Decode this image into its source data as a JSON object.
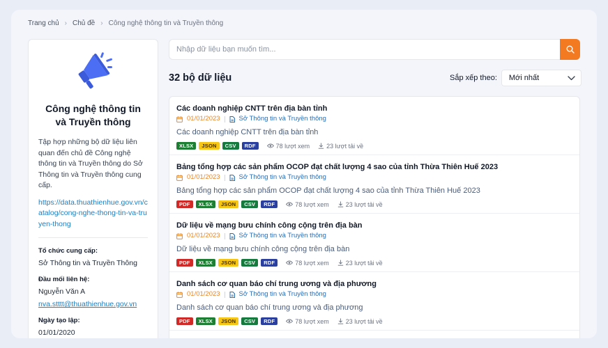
{
  "breadcrumb": {
    "home": "Trang chủ",
    "topics": "Chủ đề",
    "current": "Công nghệ thông tin và Truyền thông"
  },
  "sidebar": {
    "icon": "megaphone-icon",
    "title": "Công nghệ thông tin và Truyền thông",
    "description": "Tập hợp những bộ dữ liệu liên quan đến chủ đề Công nghệ thông tin và Truyền thông do Sở Thông tin và Truyền thông cung cấp.",
    "link": "https://data.thuathienhue.gov.vn/catalog/cong-nghe-thong-tin-va-truyen-thong",
    "provider_label": "Tổ chức cung cấp:",
    "provider_value": "Sở Thông tin và Truyền Thông",
    "contact_label": "Đầu mối liên hệ:",
    "contact_name": "Nguyễn Văn A",
    "contact_email": "nva.stttt@thuathienhue.gov.vn",
    "created_label": "Ngày tạo lập:",
    "created_value": "01/01/2020"
  },
  "search": {
    "placeholder": "Nhập dữ liệu bạn muốn tìm..."
  },
  "results": {
    "count_label": "32 bộ dữ liệu",
    "sort_label": "Sắp xếp theo:",
    "sort_value": "Mới nhất"
  },
  "colors": {
    "accent": "#f47a22",
    "link": "#1d7fc2"
  },
  "datasets": [
    {
      "title": "Các doanh nghiệp CNTT trên địa bàn tỉnh",
      "date": "01/01/2023",
      "org": "Sở Thông tin và Truyền thông",
      "desc": "Các doanh nghiệp CNTT trên địa bàn tỉnh",
      "formats": [
        "XLSX",
        "JSON",
        "CSV",
        "RDF"
      ],
      "views": "78 lượt xem",
      "downloads": "23 lượt tải về"
    },
    {
      "title": "Bảng tổng hợp các sản phẩm OCOP đạt chất lượng 4 sao của tỉnh Thừa Thiên Huế 2023",
      "date": "01/01/2023",
      "org": "Sở Thông tin và Truyền thông",
      "desc": "Bảng tổng hợp các sản phẩm OCOP đạt chất lượng 4 sao của tỉnh Thừa Thiên Huế 2023",
      "formats": [
        "PDF",
        "XLSX",
        "JSON",
        "CSV",
        "RDF"
      ],
      "views": "78 lượt xem",
      "downloads": "23 lượt tải về"
    },
    {
      "title": "Dữ liệu về mạng bưu chính công cộng trên địa bàn",
      "date": "01/01/2023",
      "org": "Sở Thông tin và Truyền thông",
      "desc": "Dữ liệu về mạng bưu chính công cộng trên địa bàn",
      "formats": [
        "PDF",
        "XLSX",
        "JSON",
        "CSV",
        "RDF"
      ],
      "views": "78 lượt xem",
      "downloads": "23 lượt tải về"
    },
    {
      "title": "Danh sách cơ quan báo chí trung ương và địa phương",
      "date": "01/01/2023",
      "org": "Sở Thông tin và Truyền thông",
      "desc": "Danh sách cơ quan báo chí trung ương và địa phương",
      "formats": [
        "PDF",
        "XLSX",
        "JSON",
        "CSV",
        "RDF"
      ],
      "views": "78 lượt xem",
      "downloads": "23 lượt tải về"
    }
  ]
}
